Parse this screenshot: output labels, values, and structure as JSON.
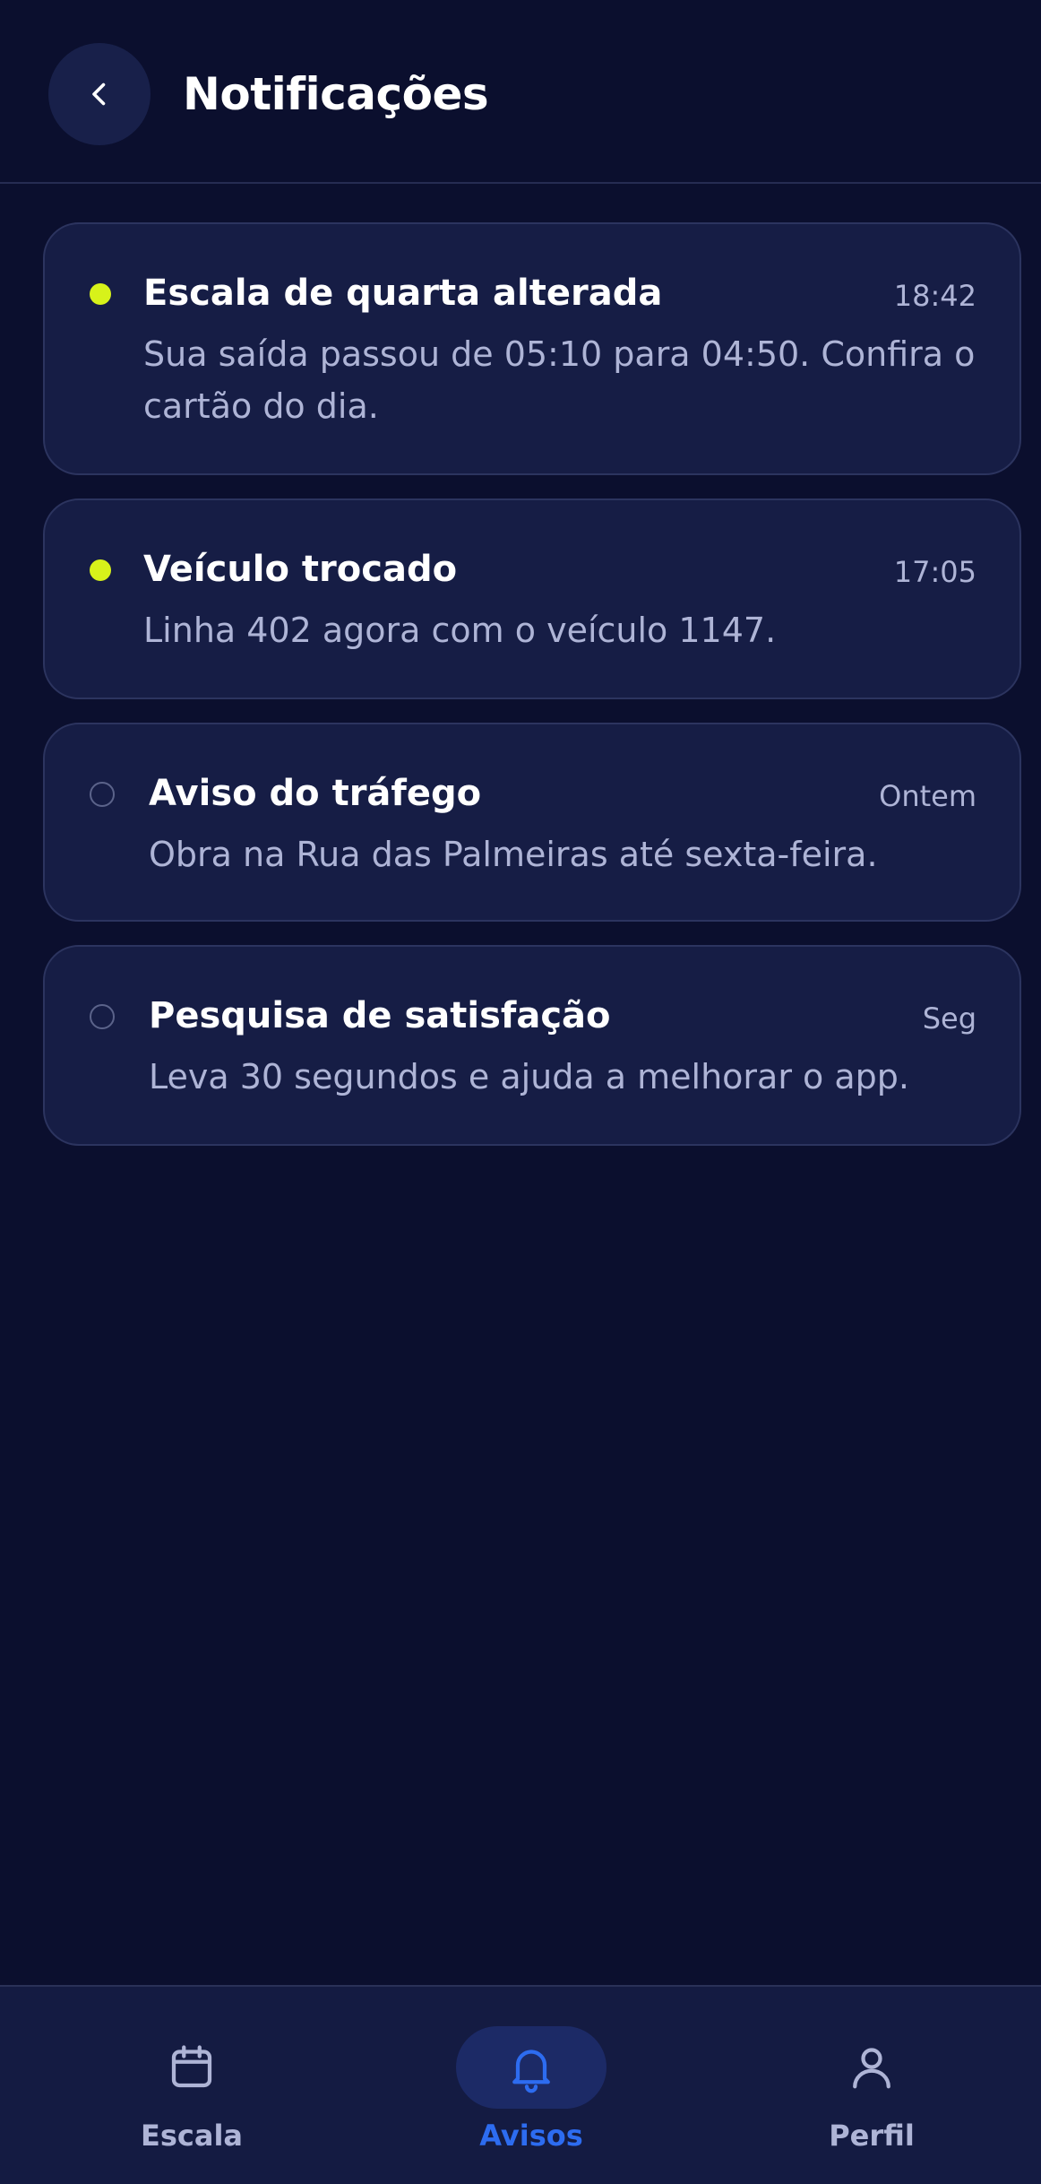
{
  "header": {
    "title": "Notificações",
    "back_icon": "chevron-left-icon"
  },
  "notifications": [
    {
      "title": "Escala de quarta alterada",
      "time": "18:42",
      "body": "Sua saída passou de 05:10 para 04:50. Confira o cartão do dia.",
      "unread": true
    },
    {
      "title": "Veículo trocado",
      "time": "17:05",
      "body": "Linha 402 agora com o veículo 1147.",
      "unread": true
    },
    {
      "title": "Aviso do tráfego",
      "time": "Ontem",
      "body": "Obra na Rua das Palmeiras até sexta-feira.",
      "unread": false
    },
    {
      "title": "Pesquisa de satisfação",
      "time": "Seg",
      "body": "Leva 30 segundos e ajuda a melhorar o app.",
      "unread": false
    }
  ],
  "bottom_nav": {
    "items": [
      {
        "label": "Escala",
        "icon": "calendar-icon",
        "active": false
      },
      {
        "label": "Avisos",
        "icon": "bell-icon",
        "active": true
      },
      {
        "label": "Perfil",
        "icon": "user-icon",
        "active": false
      }
    ]
  },
  "colors": {
    "background": "#0b0f2e",
    "card": "#161d45",
    "unread_dot": "#d7f21a",
    "active_nav": "#2d6cf0",
    "muted_text": "#aeb4d6"
  }
}
